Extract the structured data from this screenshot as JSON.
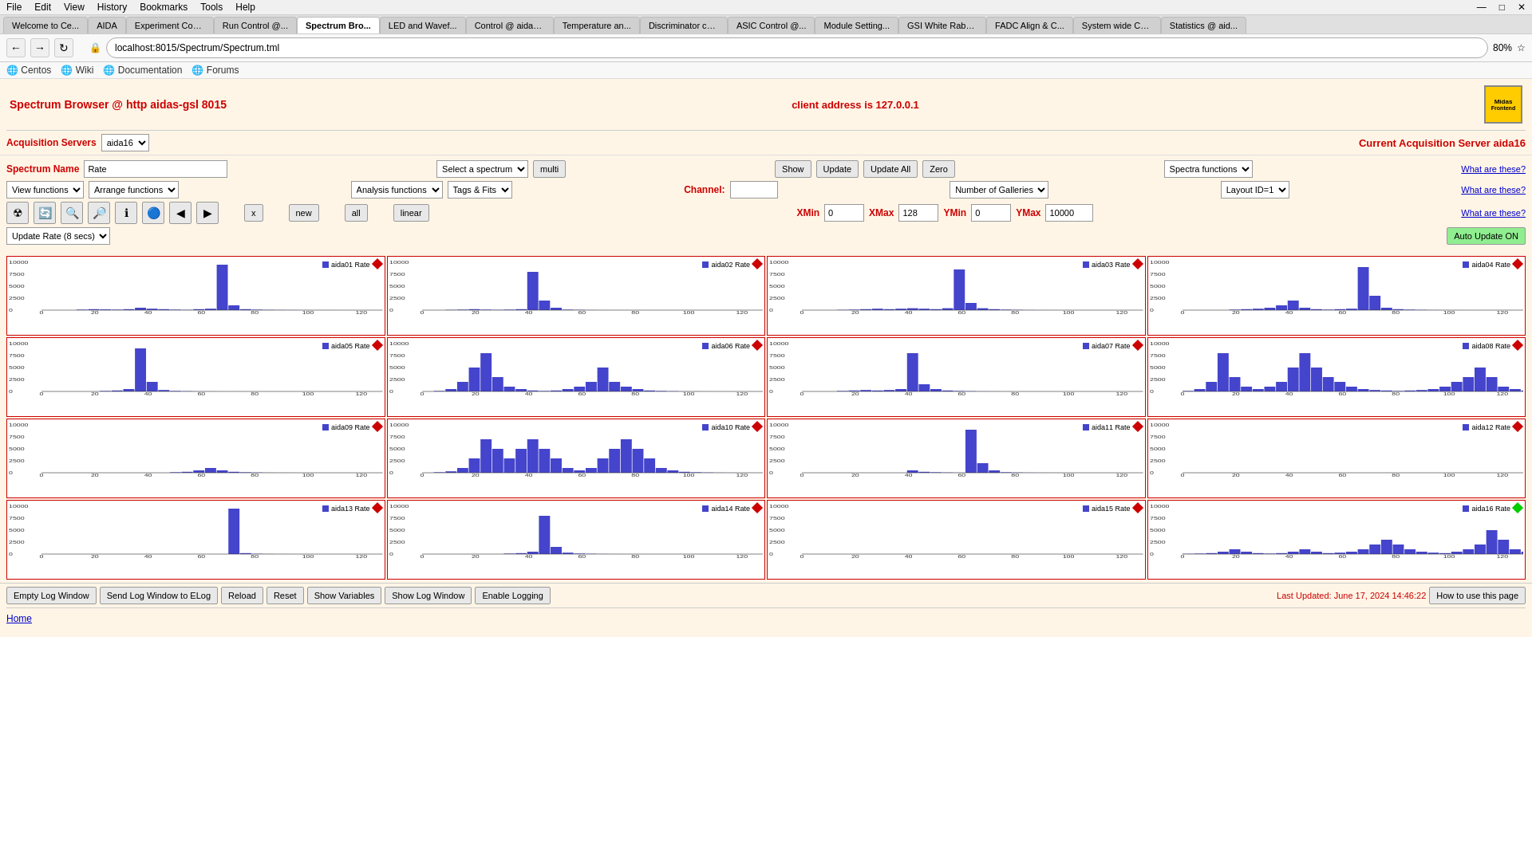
{
  "browser": {
    "menubar": [
      "File",
      "Edit",
      "View",
      "History",
      "Bookmarks",
      "Tools",
      "Help"
    ],
    "url": "localhost:8015/Spectrum/Spectrum.tml",
    "zoom": "80%",
    "tabs": [
      {
        "label": "Welcome to Ce...",
        "active": false
      },
      {
        "label": "AIDA",
        "active": false
      },
      {
        "label": "Experiment Con...",
        "active": false
      },
      {
        "label": "Run Control @...",
        "active": false
      },
      {
        "label": "Spectrum Bro...",
        "active": true
      },
      {
        "label": "LED and Wavef...",
        "active": false
      },
      {
        "label": "Control @ aidas...",
        "active": false
      },
      {
        "label": "Temperature an...",
        "active": false
      },
      {
        "label": "Discriminator co...",
        "active": false
      },
      {
        "label": "ASIC Control @...",
        "active": false
      },
      {
        "label": "Module Setting...",
        "active": false
      },
      {
        "label": "GSI White Rabb...",
        "active": false
      },
      {
        "label": "FADC Align & C...",
        "active": false
      },
      {
        "label": "System wide Ch...",
        "active": false
      },
      {
        "label": "Statistics @ aid...",
        "active": false
      }
    ],
    "bookmarks": [
      "Centos",
      "Wiki",
      "Documentation",
      "Forums"
    ]
  },
  "page": {
    "title": "Spectrum Browser @ http aidas-gsl 8015",
    "client_address": "client address is 127.0.0.1"
  },
  "acq_bar": {
    "label": "Acquisition Servers",
    "server_select": "aida16",
    "current_label": "Current Acquisition Server aida16"
  },
  "controls": {
    "spectrum_name_label": "Spectrum Name",
    "spectrum_name_value": "Rate",
    "select_spectrum_label": "Select a spectrum",
    "multi_label": "multi",
    "show_label": "Show",
    "update_label": "Update",
    "update_all_label": "Update All",
    "zero_label": "Zero",
    "spectra_functions_label": "Spectra functions",
    "what_are_these1": "What are these?",
    "view_functions_label": "View functions",
    "arrange_functions_label": "Arrange functions",
    "analysis_functions_label": "Analysis functions",
    "tags_fits_label": "Tags & Fits",
    "channel_label": "Channel:",
    "channel_value": "",
    "number_of_galleries_label": "Number of Galleries",
    "layout_id_label": "Layout ID=1",
    "what_are_these2": "What are these?",
    "x_label": "x",
    "new_label": "new",
    "all_label": "all",
    "linear_label": "linear",
    "xmin_label": "XMin",
    "xmin_value": "0",
    "xmax_label": "XMax",
    "xmax_value": "128",
    "ymin_label": "YMin",
    "ymin_value": "0",
    "ymax_label": "YMax",
    "ymax_value": "10000",
    "what_are_these3": "What are these?",
    "update_rate_label": "Update Rate (8 secs)",
    "auto_update_label": "Auto Update ON"
  },
  "galleries": [
    {
      "name": "aida01 Rate",
      "green": false
    },
    {
      "name": "aida02 Rate",
      "green": false
    },
    {
      "name": "aida03 Rate",
      "green": false
    },
    {
      "name": "aida04 Rate",
      "green": false
    },
    {
      "name": "aida05 Rate",
      "green": false
    },
    {
      "name": "aida06 Rate",
      "green": false
    },
    {
      "name": "aida07 Rate",
      "green": false
    },
    {
      "name": "aida08 Rate",
      "green": false
    },
    {
      "name": "aida09 Rate",
      "green": false
    },
    {
      "name": "aida10 Rate",
      "green": false
    },
    {
      "name": "aida11 Rate",
      "green": false
    },
    {
      "name": "aida12 Rate",
      "green": false
    },
    {
      "name": "aida13 Rate",
      "green": false
    },
    {
      "name": "aida14 Rate",
      "green": false
    },
    {
      "name": "aida15 Rate",
      "green": false
    },
    {
      "name": "aida16 Rate",
      "green": true
    }
  ],
  "bottom_bar": {
    "empty_log": "Empty Log Window",
    "send_log": "Send Log Window to ELog",
    "reload": "Reload",
    "reset": "Reset",
    "show_variables": "Show Variables",
    "show_log_window": "Show Log Window",
    "enable_logging": "Enable Logging",
    "last_updated": "Last Updated: June 17, 2024 14:46:22",
    "how_use": "How to use this page"
  },
  "footer": {
    "home_label": "Home"
  }
}
